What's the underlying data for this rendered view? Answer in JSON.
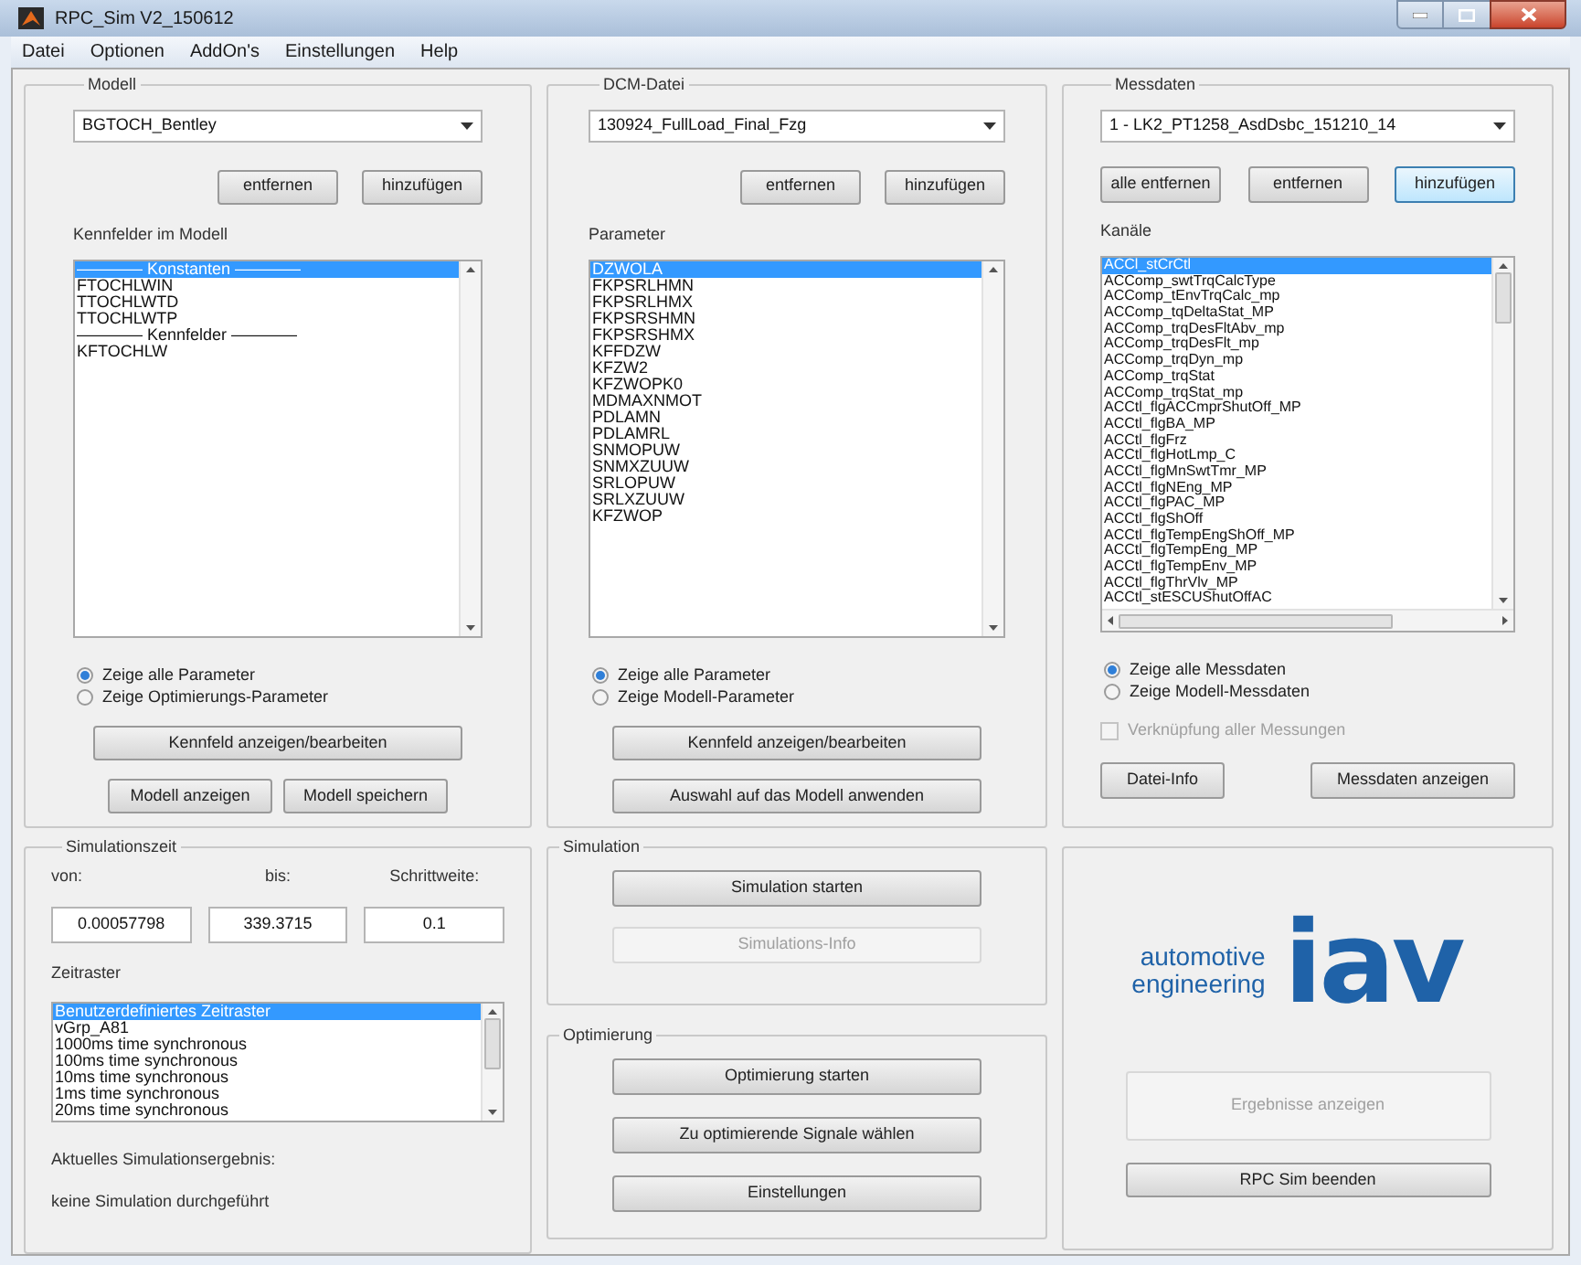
{
  "window": {
    "title": "RPC_Sim V2_150612"
  },
  "menu": [
    "Datei",
    "Optionen",
    "AddOn's",
    "Einstellungen",
    "Help"
  ],
  "modell": {
    "title": "Modell",
    "dropdown": "BGTOCH_Bentley",
    "buttons": [
      "entfernen",
      "hinzufügen"
    ],
    "list_label": "Kennfelder im Modell",
    "list": [
      {
        "text": "———— Konstanten ————",
        "selected": true
      },
      {
        "text": "FTOCHLWIN",
        "selected": false
      },
      {
        "text": "TTOCHLWTD",
        "selected": false
      },
      {
        "text": "TTOCHLWTP",
        "selected": false
      },
      {
        "text": "———— Kennfelder ————",
        "selected": false
      },
      {
        "text": "KFTOCHLW",
        "selected": false
      }
    ],
    "radios": [
      {
        "label": "Zeige alle Parameter",
        "selected": true
      },
      {
        "label": "Zeige Optimierungs-Parameter",
        "selected": false
      }
    ],
    "wide_button": "Kennfeld anzeigen/bearbeiten",
    "bottom_buttons": [
      "Modell anzeigen",
      "Modell speichern"
    ]
  },
  "dcm": {
    "title": "DCM-Datei",
    "dropdown": "130924_FullLoad_Final_Fzg",
    "buttons": [
      "entfernen",
      "hinzufügen"
    ],
    "list_label": "Parameter",
    "list": [
      {
        "text": "DZWOLA",
        "selected": true
      },
      {
        "text": "FKPSRLHMN",
        "selected": false
      },
      {
        "text": "FKPSRLHMX",
        "selected": false
      },
      {
        "text": "FKPSRSHMN",
        "selected": false
      },
      {
        "text": "FKPSRSHMX",
        "selected": false
      },
      {
        "text": "KFFDZW",
        "selected": false
      },
      {
        "text": "KFZW2",
        "selected": false
      },
      {
        "text": "KFZWOPK0",
        "selected": false
      },
      {
        "text": "MDMAXNMOT",
        "selected": false
      },
      {
        "text": "PDLAMN",
        "selected": false
      },
      {
        "text": "PDLAMRL",
        "selected": false
      },
      {
        "text": "SNMOPUW",
        "selected": false
      },
      {
        "text": "SNMXZUUW",
        "selected": false
      },
      {
        "text": "SRLOPUW",
        "selected": false
      },
      {
        "text": "SRLXZUUW",
        "selected": false
      },
      {
        "text": "KFZWOP",
        "selected": false
      }
    ],
    "radios": [
      {
        "label": "Zeige alle Parameter",
        "selected": true
      },
      {
        "label": "Zeige Modell-Parameter",
        "selected": false
      }
    ],
    "wide_buttons": [
      "Kennfeld anzeigen/bearbeiten",
      "Auswahl auf das Modell anwenden"
    ]
  },
  "messdaten": {
    "title": "Messdaten",
    "dropdown": "1 - LK2_PT1258_AsdDsbc_151210_14",
    "buttons": [
      {
        "label": "alle entfernen",
        "focused": false
      },
      {
        "label": "entfernen",
        "focused": false
      },
      {
        "label": "hinzufügen",
        "focused": true
      }
    ],
    "list_label": "Kanäle",
    "list": [
      {
        "text": "ACCl_stCrCtl",
        "selected": true
      },
      {
        "text": "ACComp_swtTrqCalcType",
        "selected": false
      },
      {
        "text": "ACComp_tEnvTrqCalc_mp",
        "selected": false
      },
      {
        "text": "ACComp_tqDeltaStat_MP",
        "selected": false
      },
      {
        "text": "ACComp_trqDesFltAbv_mp",
        "selected": false
      },
      {
        "text": "ACComp_trqDesFlt_mp",
        "selected": false
      },
      {
        "text": "ACComp_trqDyn_mp",
        "selected": false
      },
      {
        "text": "ACComp_trqStat",
        "selected": false
      },
      {
        "text": "ACComp_trqStat_mp",
        "selected": false
      },
      {
        "text": "ACCtl_flgACCmprShutOff_MP",
        "selected": false
      },
      {
        "text": "ACCtl_flgBA_MP",
        "selected": false
      },
      {
        "text": "ACCtl_flgFrz",
        "selected": false
      },
      {
        "text": "ACCtl_flgHotLmp_C",
        "selected": false
      },
      {
        "text": "ACCtl_flgMnSwtTmr_MP",
        "selected": false
      },
      {
        "text": "ACCtl_flgNEng_MP",
        "selected": false
      },
      {
        "text": "ACCtl_flgPAC_MP",
        "selected": false
      },
      {
        "text": "ACCtl_flgShOff",
        "selected": false
      },
      {
        "text": "ACCtl_flgTempEngShOff_MP",
        "selected": false
      },
      {
        "text": "ACCtl_flgTempEng_MP",
        "selected": false
      },
      {
        "text": "ACCtl_flgTempEnv_MP",
        "selected": false
      },
      {
        "text": "ACCtl_flgThrVlv_MP",
        "selected": false
      },
      {
        "text": "ACCtl_stESCUShutOffAC",
        "selected": false
      }
    ],
    "radios": [
      {
        "label": "Zeige alle Messdaten",
        "selected": true
      },
      {
        "label": "Zeige Modell-Messdaten",
        "selected": false
      }
    ],
    "checkbox": {
      "label": "Verknüpfung aller Messungen",
      "checked": false,
      "disabled": true
    },
    "bottom_buttons": [
      "Datei-Info",
      "Messdaten anzeigen"
    ]
  },
  "simulationszeit": {
    "title": "Simulationszeit",
    "fields": [
      {
        "label": "von:",
        "value": "0.00057798"
      },
      {
        "label": "bis:",
        "value": "339.3715"
      },
      {
        "label": "Schrittweite:",
        "value": "0.1"
      }
    ],
    "list_label": "Zeitraster",
    "list": [
      {
        "text": "Benutzerdefiniertes Zeitraster",
        "selected": true
      },
      {
        "text": "vGrp_A81",
        "selected": false
      },
      {
        "text": "1000ms time synchronous",
        "selected": false
      },
      {
        "text": "100ms time synchronous",
        "selected": false
      },
      {
        "text": "10ms time synchronous",
        "selected": false
      },
      {
        "text": "1ms time synchronous",
        "selected": false
      },
      {
        "text": "20ms time synchronous",
        "selected": false
      }
    ],
    "result_label": "Aktuelles Simulationsergebnis:",
    "result": "keine Simulation durchgeführt"
  },
  "simulation": {
    "title": "Simulation",
    "buttons": [
      {
        "label": "Simulation starten",
        "disabled": false
      },
      {
        "label": "Simulations-Info",
        "disabled": true
      }
    ]
  },
  "optimierung": {
    "title": "Optimierung",
    "buttons": [
      "Optimierung starten",
      "Zu optimierende Signale wählen",
      "Einstellungen"
    ]
  },
  "logo_panel": {
    "logo": {
      "line_1": "automotive",
      "line_2": "engineering",
      "wordmark": "iav"
    },
    "buttons": [
      {
        "label": "Ergebnisse anzeigen",
        "disabled": true
      },
      {
        "label": "RPC Sim beenden",
        "disabled": false
      }
    ]
  }
}
